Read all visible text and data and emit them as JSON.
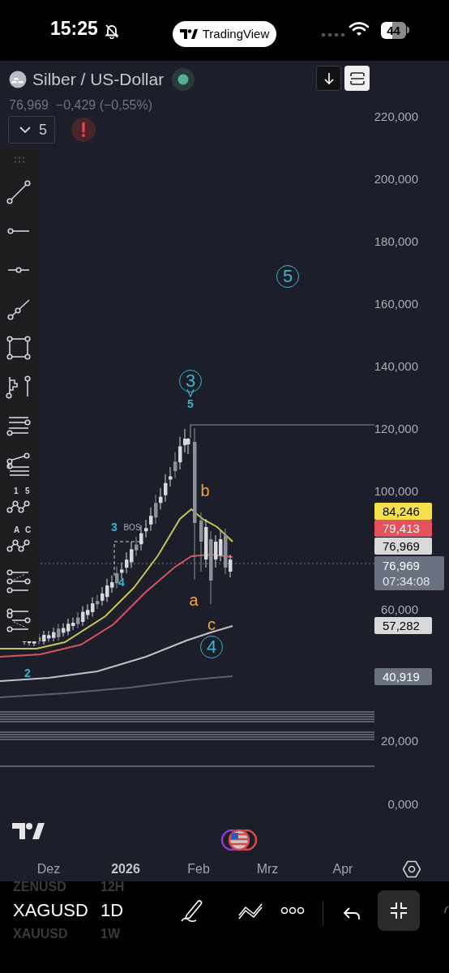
{
  "status_bar": {
    "time": "15:25",
    "app": "TradingView",
    "battery": "44"
  },
  "header": {
    "symbol": "Silber / US-Dollar",
    "price": "76,969",
    "change": "−0,429 (−0,55%)",
    "indicator_count": "5"
  },
  "drawing_tools": [
    {
      "kind": "trend-line"
    },
    {
      "kind": "ray"
    },
    {
      "kind": "horizontal"
    },
    {
      "kind": "extended"
    },
    {
      "kind": "rectangle"
    },
    {
      "kind": "volume-pin"
    },
    {
      "kind": "parallel"
    },
    {
      "kind": "fib"
    },
    {
      "kind": "pattern",
      "labels": [
        "1",
        "5"
      ]
    },
    {
      "kind": "pattern",
      "labels": [
        "A",
        "C"
      ]
    },
    {
      "kind": "channel"
    },
    {
      "kind": "channel-down"
    }
  ],
  "price_axis": [
    "220,000",
    "200,000",
    "180,000",
    "160,000",
    "140,000",
    "120,000",
    "100,000",
    "60,000",
    "20,000",
    "0,000"
  ],
  "price_tags": [
    {
      "value": "84,246",
      "color": "#f5df4d"
    },
    {
      "value": "79,413",
      "color": "#e5525c"
    },
    {
      "value": "76,969",
      "color": "#d9d9d9"
    },
    {
      "value": "76,969",
      "countdown": "07:34:08",
      "color": "#6a7180"
    },
    {
      "value": "57,282",
      "color": "#d9d9d9"
    },
    {
      "value": "40,919",
      "color": "#6a7180"
    }
  ],
  "annotations": [
    {
      "text": "5",
      "circled": true,
      "color": "#3bb4d0"
    },
    {
      "text": "3",
      "circled": true,
      "color": "#3bb4d0"
    },
    {
      "text": "5",
      "circled": false,
      "color": "#3bb4d0"
    },
    {
      "text": "b",
      "circled": false,
      "color": "#f2a33a"
    },
    {
      "text": "3",
      "circled": false,
      "color": "#3bb4d0"
    },
    {
      "text": "BOS",
      "circled": false,
      "color": "#a9adb8"
    },
    {
      "text": "4",
      "circled": false,
      "color": "#3bb4d0"
    },
    {
      "text": "a",
      "circled": false,
      "color": "#f2a33a"
    },
    {
      "text": "c",
      "circled": false,
      "color": "#f2a33a"
    },
    {
      "text": "4",
      "circled": true,
      "color": "#3bb4d0"
    },
    {
      "text": "2",
      "circled": false,
      "color": "#3bb4d0"
    }
  ],
  "time_axis": [
    {
      "label": "Dez",
      "emphasized": false
    },
    {
      "label": "2026",
      "emphasized": true
    },
    {
      "label": "Feb",
      "emphasized": false
    },
    {
      "label": "Mrz",
      "emphasized": false
    },
    {
      "label": "Apr",
      "emphasized": false
    }
  ],
  "symbols": [
    {
      "symbol": "ZENUSD",
      "interval": "12H",
      "selected": false
    },
    {
      "symbol": "XAGUSD",
      "interval": "1D",
      "selected": true
    },
    {
      "symbol": "XAUUSD",
      "interval": "1W",
      "selected": false
    }
  ],
  "bottom_toolbar": {
    "fullscreen_active": true
  }
}
